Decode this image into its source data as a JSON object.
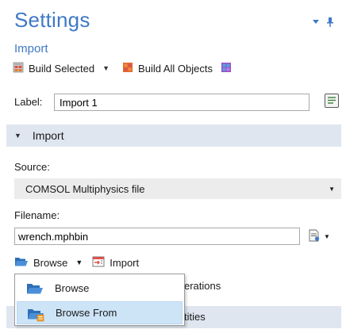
{
  "header": {
    "title": "Settings",
    "subtitle": "Import"
  },
  "toolbar": {
    "build_selected": "Build Selected",
    "build_all": "Build All Objects"
  },
  "label_field": {
    "label": "Label:",
    "value": "Import 1"
  },
  "section": {
    "title": "Import"
  },
  "source": {
    "label": "Source:",
    "value": "COMSOL Multiphysics file"
  },
  "filename": {
    "label": "Filename:",
    "value": "wrench.mphbin"
  },
  "browse_row": {
    "browse": "Browse",
    "import": "Import"
  },
  "background": {
    "checkbox_text_fragment": "erations",
    "section_text_fragment": "tities"
  },
  "menu": {
    "items": [
      {
        "label": "Browse",
        "highlighted": false
      },
      {
        "label": "Browse From",
        "highlighted": true
      }
    ]
  },
  "colors": {
    "accent": "#3f79c6",
    "section_bg": "#dfe6f0",
    "highlight": "#cde4f7"
  }
}
